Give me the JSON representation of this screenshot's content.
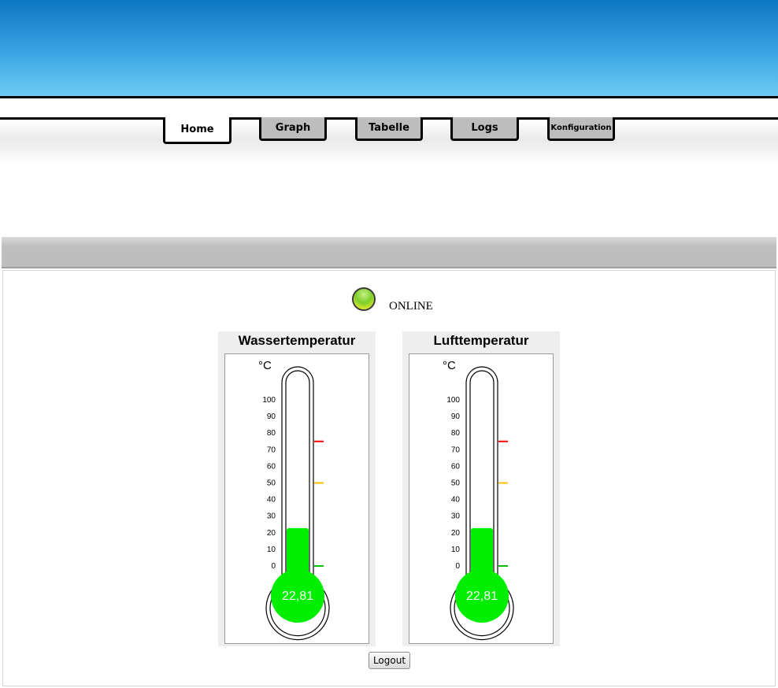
{
  "nav": {
    "tabs": [
      {
        "label": "Home",
        "active": true
      },
      {
        "label": "Graph",
        "active": false
      },
      {
        "label": "Tabelle",
        "active": false
      },
      {
        "label": "Logs",
        "active": false
      },
      {
        "label": "Konfiguration",
        "active": false
      }
    ]
  },
  "status": {
    "text": "ONLINE",
    "led_color": "#7ccf2a"
  },
  "gauges": [
    {
      "title": "Wassertemperatur",
      "unit": "°C",
      "value": 22.81,
      "value_label": "22,81"
    },
    {
      "title": "Lufttemperatur",
      "unit": "°C",
      "value": 22.81,
      "value_label": "22,81"
    }
  ],
  "scale": {
    "min": 0,
    "max": 100,
    "ticks": [
      "100",
      "90",
      "80",
      "70",
      "60",
      "50",
      "40",
      "30",
      "20",
      "10",
      "0"
    ],
    "markers": [
      {
        "value": 75,
        "color": "#ff0000"
      },
      {
        "value": 50,
        "color": "#ffc000"
      },
      {
        "value": 0,
        "color": "#00c000"
      }
    ]
  },
  "colors": {
    "mercury": "#00ee00",
    "header_top": "#0d77c4",
    "header_bottom": "#6ccbf3"
  },
  "logout": {
    "label": "Logout"
  }
}
